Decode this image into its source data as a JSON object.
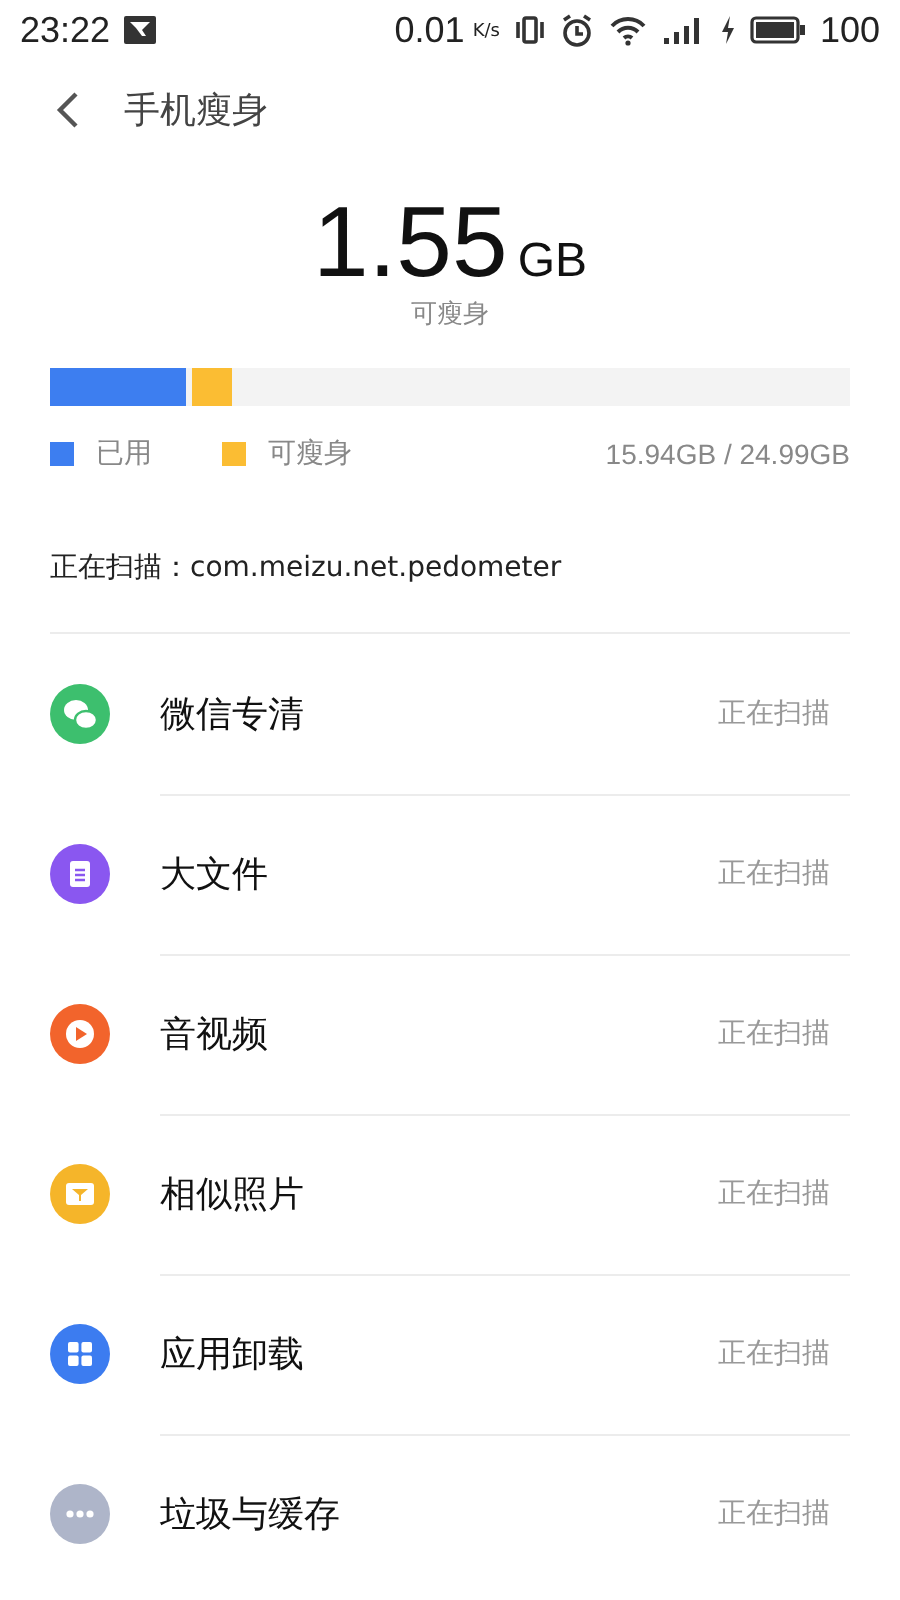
{
  "status_bar": {
    "time": "23:22",
    "speed": "0.01",
    "speed_unit": "K/s",
    "battery_text": "100"
  },
  "header": {
    "title": "手机瘦身"
  },
  "summary": {
    "amount": "1.55",
    "unit": "GB",
    "caption": "可瘦身"
  },
  "storage": {
    "segments": [
      {
        "label": "已用",
        "level": 0.17,
        "color": "#3d7ef0"
      },
      {
        "label": "可瘦身",
        "color": "#fbbd33"
      }
    ],
    "total": "15.94GB / 24.99GB"
  },
  "scan_status": "正在扫描：com.meizu.net.pedometer",
  "items": [
    {
      "kind": "chat",
      "color": "#3dbf6e",
      "title": "微信专清",
      "status": "正在扫描"
    },
    {
      "kind": "file",
      "color": "#8a57f0",
      "title": "大文件",
      "status": "正在扫描"
    },
    {
      "kind": "play",
      "color": "#f2642c",
      "title": "音视频",
      "status": "正在扫描"
    },
    {
      "kind": "photo",
      "color": "#f5b52a",
      "title": "相似照片",
      "status": "正在扫描"
    },
    {
      "kind": "apps",
      "color": "#3c7cf0",
      "title": "应用卸载",
      "status": "正在扫描"
    },
    {
      "kind": "more",
      "color": "#aeb5c9",
      "title": "垃圾与缓存",
      "status": "正在扫描"
    }
  ]
}
